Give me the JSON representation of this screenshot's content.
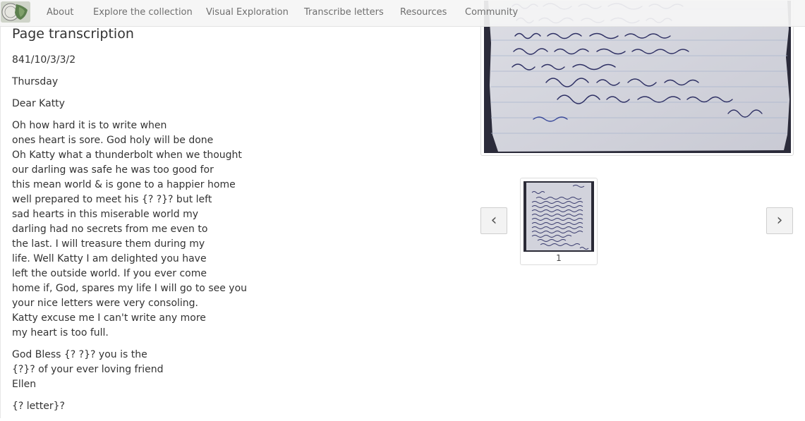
{
  "nav": {
    "items": [
      {
        "label": "About"
      },
      {
        "label": "Explore the collection"
      },
      {
        "label": "Visual Exploration"
      },
      {
        "label": "Transcribe letters"
      },
      {
        "label": "Resources"
      },
      {
        "label": "Community"
      }
    ]
  },
  "page": {
    "title": "Page transcription"
  },
  "transcription": {
    "paragraphs": [
      [
        "841/10/3/3/2"
      ],
      [
        "Thursday"
      ],
      [
        "Dear Katty"
      ],
      [
        "Oh how hard it is to write when",
        "ones heart is sore. God holy will be done",
        "Oh Katty what a thunderbolt when we thought",
        "our darling was safe he was too good for",
        "this mean world & is gone to a happier home",
        "well prepared to meet his {? ?}? but left",
        "sad hearts in this miserable world my",
        "darling had no secrets from me even to",
        "the last. I will treasure them during my",
        "life. Well Katty I am delighted you have",
        "left the outside world. If you ever come",
        "home if, God, spares my life I will go to see you",
        "your nice letters were very consoling.",
        "Katty excuse me I can't write any more",
        "my heart is too full."
      ],
      [
        "God Bless {? ?}? you is the",
        "{?}? of your ever loving friend",
        "Ellen"
      ],
      [
        "{? letter}?"
      ]
    ]
  },
  "thumbnails": {
    "items": [
      {
        "label": "1"
      }
    ],
    "prev_icon": "‹",
    "next_icon": "›"
  },
  "colors": {
    "nav_bg": "#f5f5f5",
    "text": "#333333",
    "nav_text": "#6f6f6f"
  }
}
